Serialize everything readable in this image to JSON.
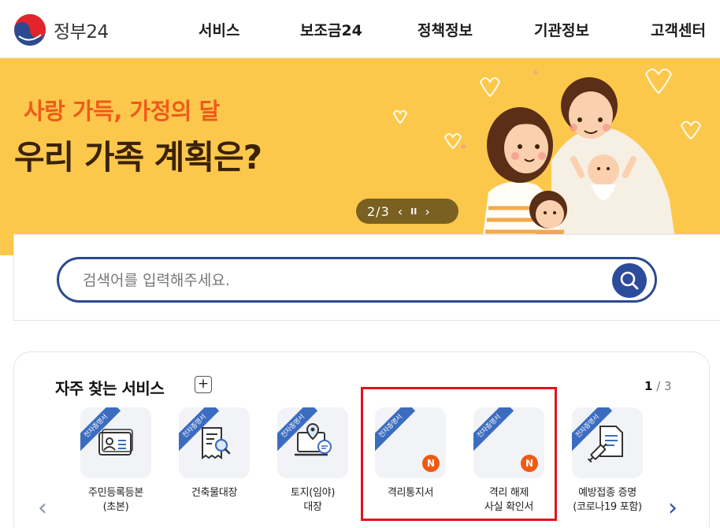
{
  "header": {
    "logo_text": "정부24",
    "nav": [
      "서비스",
      "보조금24",
      "정책정보",
      "기관정보",
      "고객센터"
    ]
  },
  "banner": {
    "subtitle": "사랑 가득, 가정의 달",
    "title": "우리 가족 계획은?",
    "pager": {
      "current": "2",
      "total": "3",
      "count_text": "2/3"
    },
    "bg_color": "#fcc84c"
  },
  "search": {
    "placeholder": "검색어를 입력해주세요."
  },
  "services": {
    "title": "자주 찾는 서비스",
    "plus_label": "+",
    "page": {
      "current": "1",
      "separator": " / ",
      "total": "3"
    },
    "ribbon_text": "전자증명서",
    "items": [
      {
        "label": "주민등록등본\n(초본)",
        "icon": "id-card-icon",
        "new": false
      },
      {
        "label": "건축물대장",
        "icon": "document-search-icon",
        "new": false
      },
      {
        "label": "토지(임야)\n대장",
        "icon": "map-pin-monitor-icon",
        "new": false
      },
      {
        "label": "격리통지서",
        "icon": "",
        "new": true,
        "badge": "N"
      },
      {
        "label": "격리 해제\n사실 확인서",
        "icon": "",
        "new": true,
        "badge": "N"
      },
      {
        "label": "예방접종 증명\n(코로나19 포함)",
        "icon": "vaccine-document-icon",
        "new": false
      }
    ]
  },
  "colors": {
    "accent_blue": "#2c4b9a",
    "badge_orange": "#ee5a14",
    "highlight_red": "#e0141c"
  }
}
